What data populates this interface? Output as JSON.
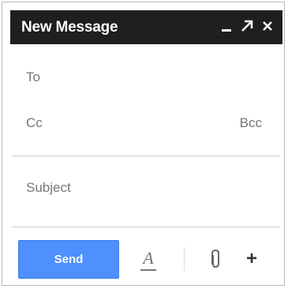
{
  "window": {
    "title": "New Message",
    "controls": [
      {
        "name": "minimize-icon"
      },
      {
        "name": "popout-icon"
      },
      {
        "name": "close-icon"
      }
    ]
  },
  "fields": {
    "to_label": "To",
    "cc_label": "Cc",
    "bcc_label": "Bcc",
    "subject_label": "Subject"
  },
  "toolbar": {
    "send_label": "Send",
    "format_label": "A",
    "icons": [
      "format-text-icon",
      "paperclip-icon",
      "plus-icon"
    ]
  },
  "colors": {
    "titlebar_bg": "#1f1f1f",
    "send_bg": "#4d90fe"
  }
}
